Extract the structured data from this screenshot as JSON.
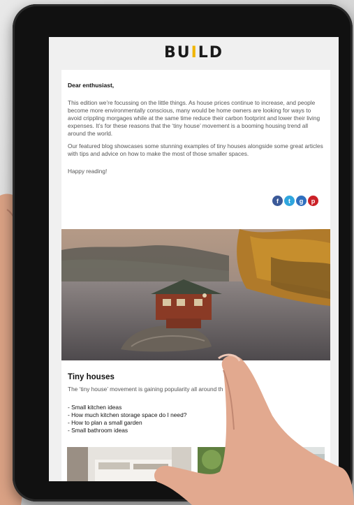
{
  "app": {
    "logo_part1": "BU",
    "logo_part2": "I",
    "logo_part3": "LD",
    "accent_color": "#f0b400"
  },
  "email": {
    "greeting": "Dear enthusiast,",
    "paragraph1": "This edition we’re focussing on the little things. As house prices continue to increase, and people become more environmentally conscious, many would be home owners are looking for ways to avoid crippling morgages while at the same time reduce their carbon footprint and lower their living expenses. It’s for these reasons that the ‘tiny house’ movement is a booming housing trend all around the world.",
    "paragraph2": "Our featured blog showcases some stunning examples of tiny houses alongside some great articles with tips and advice on how to make the most of those smaller spaces.",
    "paragraph3": "Happy reading!",
    "share_icons": [
      "facebook-icon",
      "twitter-icon",
      "google-plus-icon",
      "pinterest-icon"
    ],
    "article": {
      "title": "Tiny houses",
      "lead": "The ‘tiny house’ movement is gaining popularity all around th",
      "links": [
        "- Small kitchen ideas",
        "- How much kitchen storage space do I need?",
        "- How to plan a small garden",
        "- Small bathroom ideas"
      ]
    }
  }
}
